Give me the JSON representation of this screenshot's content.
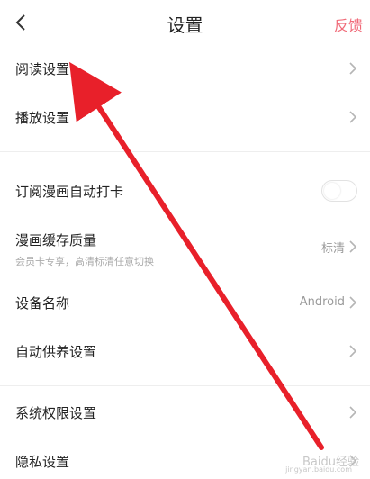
{
  "header": {
    "title": "设置",
    "feedback_label": "反馈"
  },
  "rows": [
    {
      "label": "阅读设置"
    },
    {
      "label": "播放设置"
    },
    {
      "label": "订阅漫画自动打卡",
      "toggle_on": false
    },
    {
      "label": "漫画缓存质量",
      "sub": "会员卡专享，高清标清任意切换",
      "value": "标清"
    },
    {
      "label": "设备名称",
      "value": "Android"
    },
    {
      "label": "自动供养设置"
    },
    {
      "label": "系统权限设置"
    },
    {
      "label": "隐私设置"
    }
  ],
  "watermark": {
    "text": "Baidu经验",
    "sub": "jingyan.baidu.com"
  },
  "colors": {
    "accent": "#f06a78",
    "annotation_arrow": "#e8202a"
  }
}
